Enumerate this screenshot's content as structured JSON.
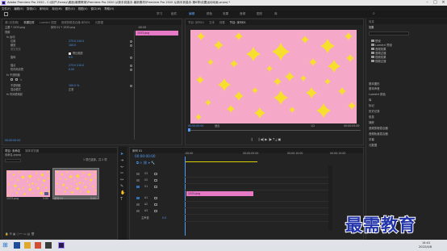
{
  "window": {
    "title": "Adobe Premiere Pro 2020 - C:\\用户\\Fsmay\\桌面\\最需教育\\Premiere Pro 2020 从新手到高手-最新素材\\Premiere Pro 2020 从新手到高手-第6章\\设置运动动画.prproj *"
  },
  "menu": [
    "文件(F)",
    "编辑(E)",
    "剪辑(C)",
    "序列(S)",
    "标记(M)",
    "图形(G)",
    "视图(V)",
    "窗口(W)",
    "帮助(H)"
  ],
  "workspaces": [
    "学习",
    "组件",
    "编辑",
    "颜色",
    "效果",
    "音频",
    "图形",
    "库"
  ],
  "effect_controls": {
    "tabs": [
      "源:(无剪辑)",
      "效果控件",
      "Lumetri 范围",
      "音频剪辑混合器:序列01",
      "元数据"
    ],
    "source_label": "主要 * 1533.png",
    "seq_label": "序列 01 * 1533.png",
    "timecode_top": ":00:00",
    "rows": [
      {
        "label": "视频",
        "value": ""
      },
      {
        "label": "fx 运动",
        "value": ""
      },
      {
        "label": "位置",
        "value": "273.0   210.0"
      },
      {
        "label": "缩放",
        "value": "100.0"
      },
      {
        "label": "缩放宽度",
        "value": ""
      },
      {
        "label": "",
        "value": "等比缩放"
      },
      {
        "label": "旋转",
        "value": "0.0"
      },
      {
        "label": "锚点",
        "value": "273.0   210.0"
      },
      {
        "label": "防闪烁滤镜",
        "value": "0.00"
      },
      {
        "label": "fx 不透明度",
        "value": ""
      },
      {
        "label": "不透明度",
        "value": "100.0 %"
      },
      {
        "label": "混合模式",
        "value": "正常"
      },
      {
        "label": "fx 时间重映射",
        "value": ""
      }
    ],
    "clip_label": "1533.png",
    "bottom_time": "00:00:00:00"
  },
  "program": {
    "tabs": [
      "节目: 序列01",
      "文本",
      "效果",
      "节目: 序列01"
    ],
    "tc_left": "00:00:00:00",
    "fit": "适合",
    "scale": "1/2",
    "tc_right": "00:00:05:00"
  },
  "right_panel": {
    "tabs": [
      "信息",
      "效果"
    ],
    "search_placeholder": "",
    "items": [
      "预设",
      "Lumetri 预设",
      "音频效果",
      "音频过渡",
      "视频效果",
      "视频过渡",
      "基本图形",
      "基本声音",
      "Lumetri 颜色",
      "库",
      "标记",
      "历史记录",
      "信息",
      "捕获",
      "音频剪辑混合器",
      "音频轨道混合器",
      "字幕",
      "元数据"
    ]
  },
  "project": {
    "tabs": [
      "项目: 未命名",
      "媒体浏览器"
    ],
    "name_label": "未命名.prproj",
    "count_label": "1 项已选择，共 2 项",
    "thumb1_label": "1533.png",
    "thumb1_dur": "5:00",
    "thumb2_label": "序列 01",
    "thumb2_dur": "5:00"
  },
  "timeline": {
    "tab": "序列 01",
    "timecode": "00:00:00:00",
    "ruler": [
      ":00:00",
      "00:00:05:00",
      "00:00:10:00",
      "00:00:15:00"
    ],
    "tracks": [
      "V3",
      "V2",
      "V1",
      "A1",
      "A2",
      "A3",
      "主声道"
    ],
    "master_value": "0.0",
    "clip_label": "1533.png"
  },
  "taskbar": {
    "time": "14:41",
    "date": "2022/4/8"
  },
  "watermark": "最需教育",
  "colors": {
    "pink": "#f6a8c8",
    "star": "#f7df2e",
    "accent": "#4f9cf8"
  }
}
